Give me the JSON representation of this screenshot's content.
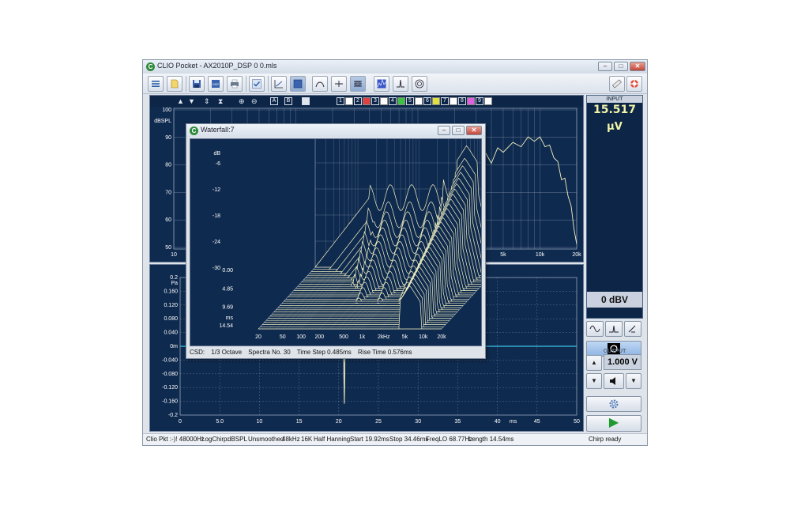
{
  "window": {
    "title": "CLIO Pocket - AX2010P_DSP 0 0.mls",
    "min_label": "–",
    "max_label": "□",
    "close_label": "✕"
  },
  "toolbar": {
    "icons": [
      "menu-icon",
      "open-file-icon",
      "save-icon",
      "export-icon",
      "print-icon",
      "check-icon",
      "frequency-response-icon",
      "impedance-icon",
      "bandpass-icon",
      "level-icon",
      "waterfall-icon",
      "spectrum-icon",
      "impulse-icon",
      "speaker-icon"
    ],
    "right_icons": [
      "ruler-icon",
      "help-lifebuoy-icon"
    ]
  },
  "upper_controls": {
    "letter_a": "A",
    "letter_b": "B",
    "channels": [
      "1",
      "2",
      "3",
      "4",
      "5",
      "6",
      "7",
      "8",
      "9"
    ],
    "channel_colors": [
      "#ffffff",
      "#e04040",
      "#ffffff",
      "#40c040",
      "#ffffff",
      "#e0e040",
      "#ffffff",
      "#e060e0",
      "#ffffff"
    ]
  },
  "upper_plot": {
    "y_unit": "dBSPL",
    "y_ticks": [
      "100",
      "90",
      "80",
      "70",
      "60",
      "50"
    ],
    "x_ticks_left": [
      "10"
    ],
    "x_ticks_right": [
      "5k",
      "10k",
      "20k"
    ]
  },
  "lower_plot": {
    "y_unit": "Pa",
    "y_ticks": [
      "0.2",
      "0.160",
      "0.120",
      "0.080",
      "0.040",
      "0m",
      "-0.040",
      "-0.080",
      "-0.120",
      "-0.160",
      "-0.2"
    ],
    "x_ticks": [
      "0",
      "5.0",
      "10",
      "15",
      "20",
      "25",
      "30",
      "35",
      "40",
      "45",
      "50"
    ],
    "x_unit": "ms"
  },
  "side_panel": {
    "input_header": "INPUT",
    "input_value": "15.517",
    "input_unit": "µV",
    "level_display": "0 dBV",
    "output_header": "OUTPUT",
    "output_value": "1.000 V",
    "up_label": "▲",
    "down_label": "▼",
    "play_label": "▶"
  },
  "status_bar": {
    "items": [
      "Clio Pkt :-)! 48000Hz",
      "LogChirp:",
      "dBSPL",
      "Unsmoothed",
      "48kHz",
      "16K",
      "Half Hanning",
      "Start 19.92ms",
      "Stop 34.46ms",
      "FreqLO 68.77Hz",
      "Length 14.54ms"
    ],
    "state": "Chirp ready"
  },
  "waterfall_window": {
    "title": "Waterfall:7",
    "y_unit": "dB",
    "y_ticks": [
      "0",
      "-6",
      "-12",
      "-18",
      "-24",
      "-30"
    ],
    "time_ticks": [
      "0.00",
      "4.85",
      "9.69",
      "14.54"
    ],
    "time_unit": "ms",
    "x_ticks": [
      "20",
      "50",
      "100",
      "200",
      "500",
      "1k",
      "2k",
      "5k",
      "10k",
      "20k"
    ],
    "x_unit": "Hz",
    "status": [
      "CSD:",
      "1/3 Octave",
      "Spectra No. 30",
      "Time Step 0.485ms",
      "Rise Time 0.576ms"
    ]
  },
  "colors": {
    "plot_bg": "#0f2a4f",
    "grid": "#8fa0b6",
    "trace": "#f4f1c0",
    "baseline": "#3cc8e8",
    "meter_text": "#f2f5a8"
  }
}
